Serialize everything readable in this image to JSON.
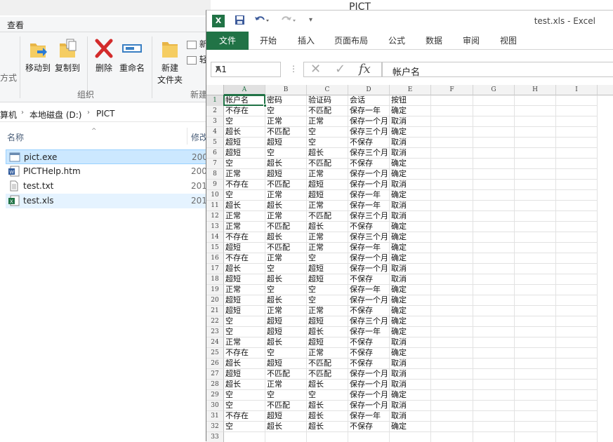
{
  "desktop": {
    "title": "PICT"
  },
  "explorer": {
    "tab_view": "查看",
    "ribbon": {
      "partial_left": "方式",
      "move_to": "移动到",
      "copy_to": "复制到",
      "delete": "删除",
      "rename": "重命名",
      "new_folder_line1": "新建",
      "new_folder_line2": "文件夹",
      "new_item_partial": "新",
      "easy_access_partial": "轻",
      "group_organize": "组织",
      "group_new": "新建"
    },
    "breadcrumb": [
      "算机",
      "本地磁盘 (D:)",
      "PICT"
    ],
    "columns": {
      "name": "名称",
      "modified": "修改"
    },
    "files": [
      {
        "name": "pict.exe",
        "date": "200",
        "icon": "exe-icon"
      },
      {
        "name": "PICTHelp.htm",
        "date": "200",
        "icon": "word-htm-icon"
      },
      {
        "name": "test.txt",
        "date": "201",
        "icon": "text-file-icon"
      },
      {
        "name": "test.xls",
        "date": "201",
        "icon": "excel-file-icon"
      }
    ]
  },
  "excel": {
    "title": "test.xls - Excel",
    "tabs": [
      "文件",
      "开始",
      "插入",
      "页面布局",
      "公式",
      "数据",
      "审阅",
      "视图"
    ],
    "name_box": "A1",
    "formula": "帐户名",
    "columns": [
      "A",
      "B",
      "C",
      "D",
      "E",
      "F",
      "G",
      "H",
      "I"
    ],
    "rows": [
      [
        "帐户名",
        "密码",
        "验证码",
        "会话",
        "按钮"
      ],
      [
        "不存在",
        "空",
        "不匹配",
        "保存一年",
        "确定"
      ],
      [
        "空",
        "正常",
        "正常",
        "保存一个月",
        "取消"
      ],
      [
        "超长",
        "不匹配",
        "空",
        "保存三个月",
        "确定"
      ],
      [
        "超短",
        "超短",
        "空",
        "不保存",
        "取消"
      ],
      [
        "超短",
        "空",
        "超长",
        "保存三个月",
        "取消"
      ],
      [
        "空",
        "超长",
        "不匹配",
        "不保存",
        "确定"
      ],
      [
        "正常",
        "超短",
        "正常",
        "保存一个月",
        "确定"
      ],
      [
        "不存在",
        "不匹配",
        "超短",
        "保存一个月",
        "取消"
      ],
      [
        "空",
        "正常",
        "超短",
        "保存一年",
        "确定"
      ],
      [
        "超长",
        "超长",
        "正常",
        "保存一年",
        "取消"
      ],
      [
        "正常",
        "正常",
        "不匹配",
        "保存三个月",
        "取消"
      ],
      [
        "正常",
        "不匹配",
        "超长",
        "不保存",
        "确定"
      ],
      [
        "不存在",
        "超长",
        "正常",
        "保存三个月",
        "确定"
      ],
      [
        "超短",
        "不匹配",
        "正常",
        "保存一年",
        "确定"
      ],
      [
        "不存在",
        "正常",
        "空",
        "保存一个月",
        "确定"
      ],
      [
        "超长",
        "空",
        "超短",
        "保存一个月",
        "取消"
      ],
      [
        "超短",
        "超长",
        "超短",
        "不保存",
        "取消"
      ],
      [
        "正常",
        "空",
        "空",
        "保存一年",
        "确定"
      ],
      [
        "超短",
        "超长",
        "空",
        "保存一个月",
        "确定"
      ],
      [
        "超短",
        "正常",
        "正常",
        "不保存",
        "确定"
      ],
      [
        "空",
        "超短",
        "超短",
        "保存三个月",
        "确定"
      ],
      [
        "空",
        "超短",
        "超长",
        "保存一年",
        "确定"
      ],
      [
        "正常",
        "超长",
        "超短",
        "不保存",
        "取消"
      ],
      [
        "不存在",
        "空",
        "正常",
        "不保存",
        "确定"
      ],
      [
        "超长",
        "超短",
        "不匹配",
        "不保存",
        "取消"
      ],
      [
        "超短",
        "不匹配",
        "不匹配",
        "保存一个月",
        "取消"
      ],
      [
        "超长",
        "正常",
        "超长",
        "保存一个月",
        "取消"
      ],
      [
        "空",
        "空",
        "空",
        "保存一个月",
        "确定"
      ],
      [
        "空",
        "不匹配",
        "超长",
        "保存一个月",
        "取消"
      ],
      [
        "不存在",
        "超短",
        "超长",
        "保存一年",
        "取消"
      ],
      [
        "空",
        "超长",
        "超长",
        "不保存",
        "确定"
      ],
      [
        "",
        "",
        "",
        "",
        ""
      ]
    ],
    "accent_color": "#217346"
  }
}
